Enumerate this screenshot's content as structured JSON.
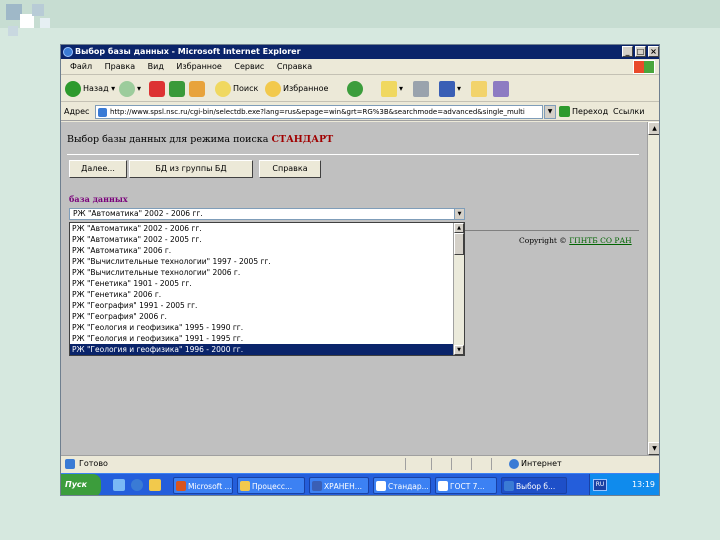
{
  "browser": {
    "window_title": "Выбор базы данных - Microsoft Internet Explorer",
    "menu": [
      "Файл",
      "Правка",
      "Вид",
      "Избранное",
      "Сервис",
      "Справка"
    ],
    "toolbar": {
      "back": "Назад",
      "search": "Поиск",
      "favorites": "Избранное"
    },
    "address_label": "Адрес",
    "address_url": "http://www.spsl.nsc.ru/cgi-bin/selectdb.exe?lang=rus&epage=win&grt=RG%3B&searchmode=advanced&single_multi",
    "go_label": "Переход",
    "links_label": "Ссылки"
  },
  "page": {
    "heading": "Выбор базы данных для режима поиска",
    "heading_mode": "СТАНДАРТ",
    "buttons": {
      "next": "Далее...",
      "group": "БД из группы БД",
      "help": "Справка"
    },
    "db_label": "база данных",
    "selected_db": "РЖ \"Автоматика\" 2002 - 2006 гг.",
    "db_options": [
      "РЖ \"Автоматика\" 2002 - 2006 гг.",
      "РЖ \"Автоматика\" 2002 - 2005 гг.",
      "РЖ \"Автоматика\" 2006 г.",
      "РЖ \"Вычислительные технологии\" 1997 - 2005 гг.",
      "РЖ \"Вычислительные технологии\" 2006 г.",
      "РЖ \"Генетика\" 1901 - 2005 гг.",
      "РЖ \"Генетика\" 2006 г.",
      "РЖ \"География\" 1991 - 2005 гг.",
      "РЖ \"География\" 2006 г.",
      "РЖ \"Геология и геофизика\" 1995 - 1990 гг.",
      "РЖ \"Геология и геофизика\" 1991 - 1995 гг.",
      "РЖ \"Геология и геофизика\" 1996 - 2000 гг."
    ],
    "selected_index": 11,
    "copyright_text": "Copyright ©",
    "copyright_link": "ГПНТБ СО РАН"
  },
  "status": {
    "text": "Готово",
    "zone": "Интернет"
  },
  "taskbar": {
    "start": "Пуск",
    "tasks": [
      "Microsoft ...",
      "Процесс...",
      "ХРАНЕН...",
      "Стандар...",
      "ГОСТ 7...",
      "Выбор б..."
    ],
    "lang": "RU",
    "clock": "13:19"
  },
  "colors": {
    "title_bar": "#0a246a",
    "selection": "#0a246a",
    "mode_text": "#a00000",
    "db_label": "#7a007a",
    "link": "#006400",
    "slide_bg": "#d6e8df"
  }
}
